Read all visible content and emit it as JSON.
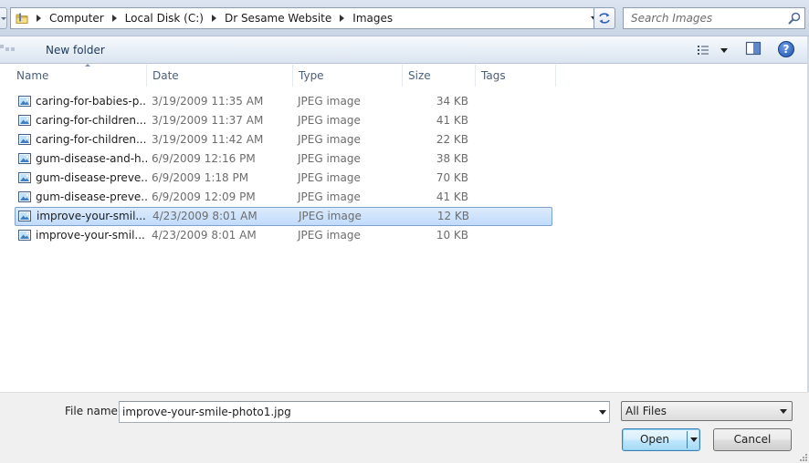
{
  "address": {
    "breadcrumbs": [
      "Computer",
      "Local Disk (C:)",
      "Dr Sesame Website",
      "Images"
    ],
    "search_placeholder": "Search Images"
  },
  "toolbar": {
    "new_folder_label": "New folder"
  },
  "columns": {
    "name": "Name",
    "date": "Date",
    "type": "Type",
    "size": "Size",
    "tags": "Tags"
  },
  "files": [
    {
      "name": "caring-for-babies-p...",
      "date": "3/19/2009 11:35 AM",
      "type": "JPEG image",
      "size": "34 KB"
    },
    {
      "name": "caring-for-children...",
      "date": "3/19/2009 11:37 AM",
      "type": "JPEG image",
      "size": "41 KB"
    },
    {
      "name": "caring-for-children...",
      "date": "3/19/2009 11:42 AM",
      "type": "JPEG image",
      "size": "22 KB"
    },
    {
      "name": "gum-disease-and-h...",
      "date": "6/9/2009 12:16 PM",
      "type": "JPEG image",
      "size": "38 KB"
    },
    {
      "name": "gum-disease-preve...",
      "date": "6/9/2009 1:18 PM",
      "type": "JPEG image",
      "size": "70 KB"
    },
    {
      "name": "gum-disease-preve...",
      "date": "6/9/2009 12:09 PM",
      "type": "JPEG image",
      "size": "41 KB"
    },
    {
      "name": "improve-your-smil...",
      "date": "4/23/2009 8:01 AM",
      "type": "JPEG image",
      "size": "12 KB",
      "selected": true
    },
    {
      "name": "improve-your-smil...",
      "date": "4/23/2009 8:01 AM",
      "type": "JPEG image",
      "size": "10 KB"
    }
  ],
  "footer": {
    "file_name_label": "File name:",
    "file_name_value": "improve-your-smile-photo1.jpg",
    "filter_selected": "All Files",
    "open_label": "Open",
    "cancel_label": "Cancel"
  },
  "colors": {
    "selection_fill": "#c1dbfc",
    "selection_border": "#7da2ce",
    "link_text": "#1e395b"
  }
}
